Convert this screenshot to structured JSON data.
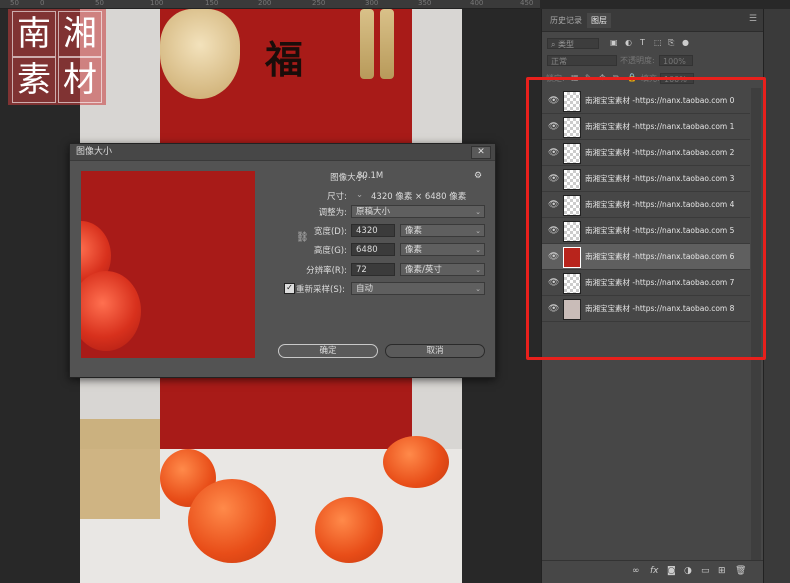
{
  "ruler": {
    "marks": [
      "50",
      "0",
      "50",
      "100",
      "150",
      "200",
      "250",
      "300",
      "350",
      "400",
      "450",
      "500",
      "550",
      "600",
      "650",
      "700",
      "750",
      "800",
      "850",
      "900",
      "950",
      "1000",
      "3500",
      "4000",
      "4500",
      "5000",
      "5500",
      "6000",
      "6500",
      "7000",
      "7500"
    ]
  },
  "logo": {
    "chars": [
      "南",
      "湘",
      "素",
      "材"
    ]
  },
  "photo": {
    "fu_char": "福"
  },
  "dialog": {
    "title": "图像大小",
    "close": "✕",
    "size_label": "图像大小:",
    "size_value": "80.1M",
    "dims_label": "尺寸:",
    "dims_value": "4320 像素 × 6480 像素",
    "fit_label": "调整为:",
    "fit_value": "原稿大小",
    "width_label": "宽度(D):",
    "width_value": "4320",
    "width_unit": "像素",
    "height_label": "高度(G):",
    "height_value": "6480",
    "height_unit": "像素",
    "res_label": "分辨率(R):",
    "res_value": "72",
    "res_unit": "像素/英寸",
    "resample_label": "重新采样(S):",
    "resample_value": "自动",
    "ok": "确定",
    "cancel": "取消"
  },
  "panel": {
    "tabs": [
      "历史记录",
      "图层"
    ],
    "kind": "类型",
    "blend": "正常",
    "opacity_label": "不透明度:",
    "opacity_value": "100%",
    "lock_label": "锁定:",
    "fill_label": "填充:",
    "fill_value": "100%",
    "layers": [
      "南湘宝宝素材 -https://nanx.taobao.com 0",
      "南湘宝宝素材 -https://nanx.taobao.com 1",
      "南湘宝宝素材 -https://nanx.taobao.com 2",
      "南湘宝宝素材 -https://nanx.taobao.com 3",
      "南湘宝宝素材 -https://nanx.taobao.com 4",
      "南湘宝宝素材 -https://nanx.taobao.com 5",
      "南湘宝宝素材 -https://nanx.taobao.com 6",
      "南湘宝宝素材 -https://nanx.taobao.com 7",
      "南湘宝宝素材 -https://nanx.taobao.com 8"
    ],
    "selected_layer": 6,
    "bottom_icons": [
      "link-icon",
      "fx-icon",
      "mask-icon",
      "adjustment-icon",
      "folder-icon",
      "new-layer-icon",
      "trash-icon"
    ]
  },
  "colors": {
    "highlight_box": "#e8201c",
    "red_backdrop": "#a81b18"
  }
}
